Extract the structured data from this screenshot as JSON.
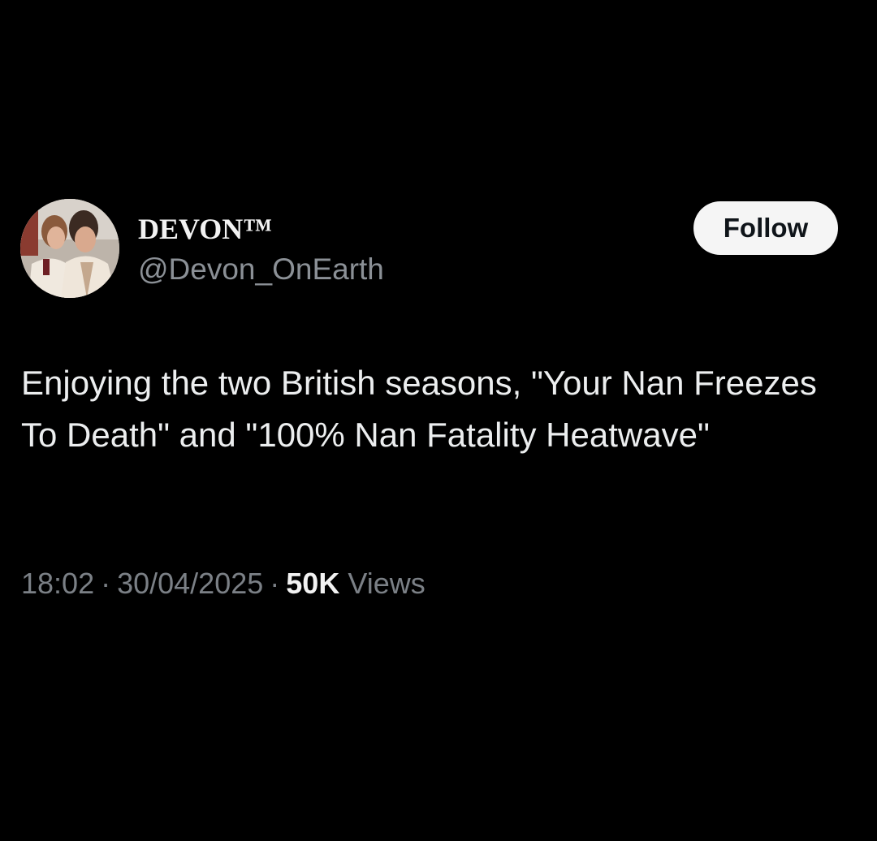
{
  "post": {
    "author": {
      "display_name": "DEVON™",
      "handle": "@Devon_OnEarth",
      "avatar_icon": "profile-photo"
    },
    "follow_label": "Follow",
    "text": "Enjoying the two British seasons, \"Your Nan Freezes To Death\" and \"100% Nan Fatality Heatwave\"",
    "time": "18:02",
    "date": "30/04/2025",
    "separator": "·",
    "views_count": "50K",
    "views_label": "Views"
  },
  "colors": {
    "background": "#000000",
    "primary_text": "#e7e9ea",
    "secondary_text": "#7b8086",
    "button_bg": "#f5f5f5",
    "button_text": "#0f1419"
  }
}
